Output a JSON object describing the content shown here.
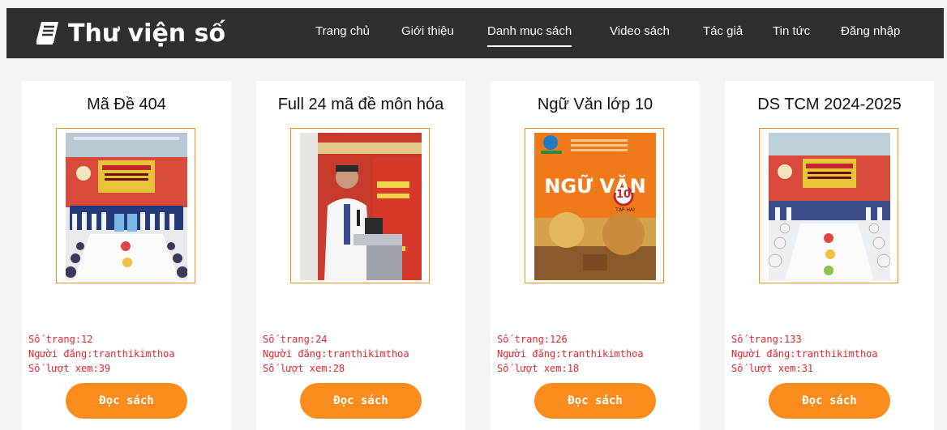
{
  "brand": {
    "name": "Thư viện số",
    "icon": "book-icon"
  },
  "nav": {
    "items": [
      {
        "label": "Trang chủ"
      },
      {
        "label": "Giới thiệu"
      },
      {
        "label": "Danh mục sách",
        "active": true
      },
      {
        "label": "Video sách"
      },
      {
        "label": "Tác giả"
      },
      {
        "label": "Tin tức"
      },
      {
        "label": "Đăng nhập"
      }
    ]
  },
  "books": [
    {
      "title": "Mã Đề 404",
      "pages": "Số trang:12",
      "poster": "Người đăng:tranthikimthoa",
      "views": "Số lượt xem:39",
      "button": "Đọc sách",
      "cover": "conference-photo"
    },
    {
      "title": "Full 24 mã đề môn hóa",
      "pages": "Số trang:24",
      "poster": "Người đăng:tranthikimthoa",
      "views": "Số lượt xem:28",
      "button": "Đọc sách",
      "cover": "speaker-photo"
    },
    {
      "title": "Ngữ Văn lớp 10",
      "pages": "Số trang:126",
      "poster": "Người đăng:tranthikimthoa",
      "views": "Số lượt xem:18",
      "button": "Đọc sách",
      "cover": "textbook-cover",
      "cover_title": "NGỮ VĂN",
      "cover_grade": "10",
      "cover_sub": "TẬP HAI"
    },
    {
      "title": "DS TCM 2024-2025",
      "pages": "Số trang:133",
      "poster": "Người đăng:tranthikimthoa",
      "views": "Số lượt xem:31",
      "button": "Đọc sách",
      "cover": "conference-photo"
    }
  ],
  "colors": {
    "accent": "#fa8c1d",
    "meta_text": "#e3262c",
    "nav_bg": "#2f2f2f",
    "frame": "#f0902a"
  }
}
